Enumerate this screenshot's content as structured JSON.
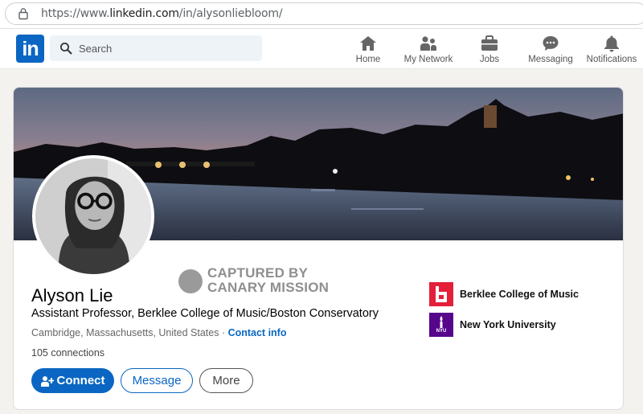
{
  "browser": {
    "url_prefix": "https://www.",
    "url_domain": "linkedin.com",
    "url_path": "/in/alysonliebloom/"
  },
  "nav": {
    "logo_text": "in",
    "search_placeholder": "Search",
    "items": [
      {
        "label": "Home",
        "icon": "home-icon"
      },
      {
        "label": "My Network",
        "icon": "network-icon"
      },
      {
        "label": "Jobs",
        "icon": "briefcase-icon"
      },
      {
        "label": "Messaging",
        "icon": "messaging-icon"
      },
      {
        "label": "Notifications",
        "icon": "bell-icon"
      }
    ]
  },
  "watermark": {
    "line1": "CAPTURED BY",
    "line2": "CANARY MISSION"
  },
  "profile": {
    "name": "Alyson Lie",
    "headline": "Assistant Professor, Berklee College of Music/Boston Conservatory",
    "location": "Cambridge, Massachusetts, United States",
    "separator": " · ",
    "contact_info": "Contact info",
    "connections": "105 connections"
  },
  "actions": {
    "connect": "Connect",
    "message": "Message",
    "more": "More"
  },
  "education": [
    {
      "name": "Berklee College of Music",
      "color": "#e41f3a"
    },
    {
      "name": "New York University",
      "color": "#57068c",
      "logo_text": "NYU"
    }
  ],
  "colors": {
    "accent": "#0a66c2",
    "background": "#f3f2ef"
  }
}
